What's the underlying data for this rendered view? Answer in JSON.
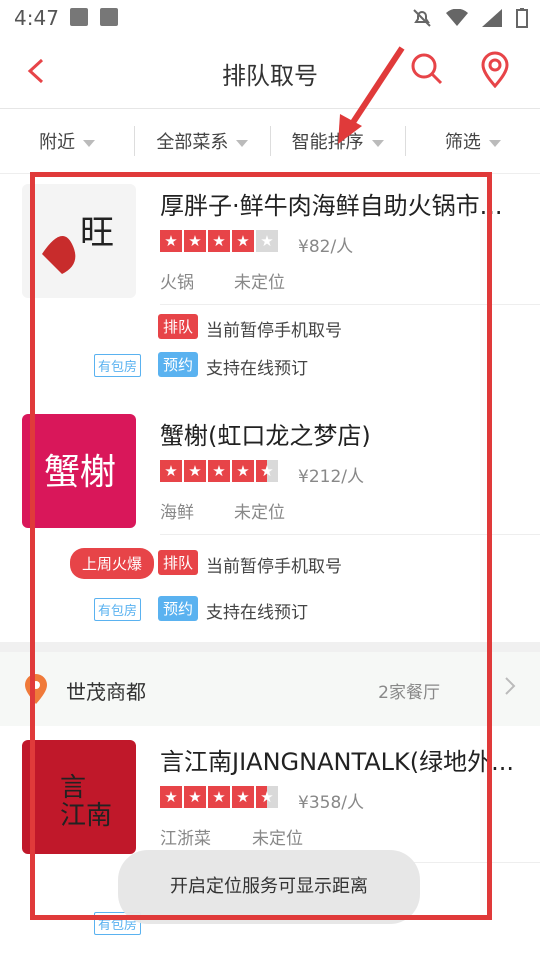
{
  "status": {
    "time": "4:47"
  },
  "nav": {
    "title": "排队取号"
  },
  "filters": [
    {
      "label": "附近"
    },
    {
      "label": "全部菜系"
    },
    {
      "label": "智能排序"
    },
    {
      "label": "筛选"
    }
  ],
  "restaurants": [
    {
      "name": "厚胖子·鲜牛肉海鲜自助火锅市...",
      "rating": 4,
      "price": "¥82/人",
      "category": "火锅",
      "location": "未定位",
      "queue_tag": "排队",
      "queue_text": "当前暂停手机取号",
      "book_tag": "预约",
      "book_text": "支持在线预订",
      "room_badge": "有包房"
    },
    {
      "name": "蟹榭(虹口龙之梦店)",
      "rating": 4.5,
      "price": "¥212/人",
      "category": "海鲜",
      "location": "未定位",
      "hot_badge": "上周火爆",
      "queue_tag": "排队",
      "queue_text": "当前暂停手机取号",
      "book_tag": "预约",
      "book_text": "支持在线预订",
      "room_badge": "有包房"
    },
    {
      "name": "言江南JIANGNANTALK(绿地外...",
      "rating": 4.5,
      "price": "¥358/人",
      "category": "江浙菜",
      "location": "未定位",
      "room_badge": "有包房"
    }
  ],
  "mall": {
    "name": "世茂商都",
    "count": "2家餐厅"
  },
  "toast": {
    "text": "开启定位服务可显示距离"
  },
  "colors": {
    "accent": "#e74448",
    "blue": "#5ab2f0",
    "highlight_box": "#e03a3a"
  }
}
